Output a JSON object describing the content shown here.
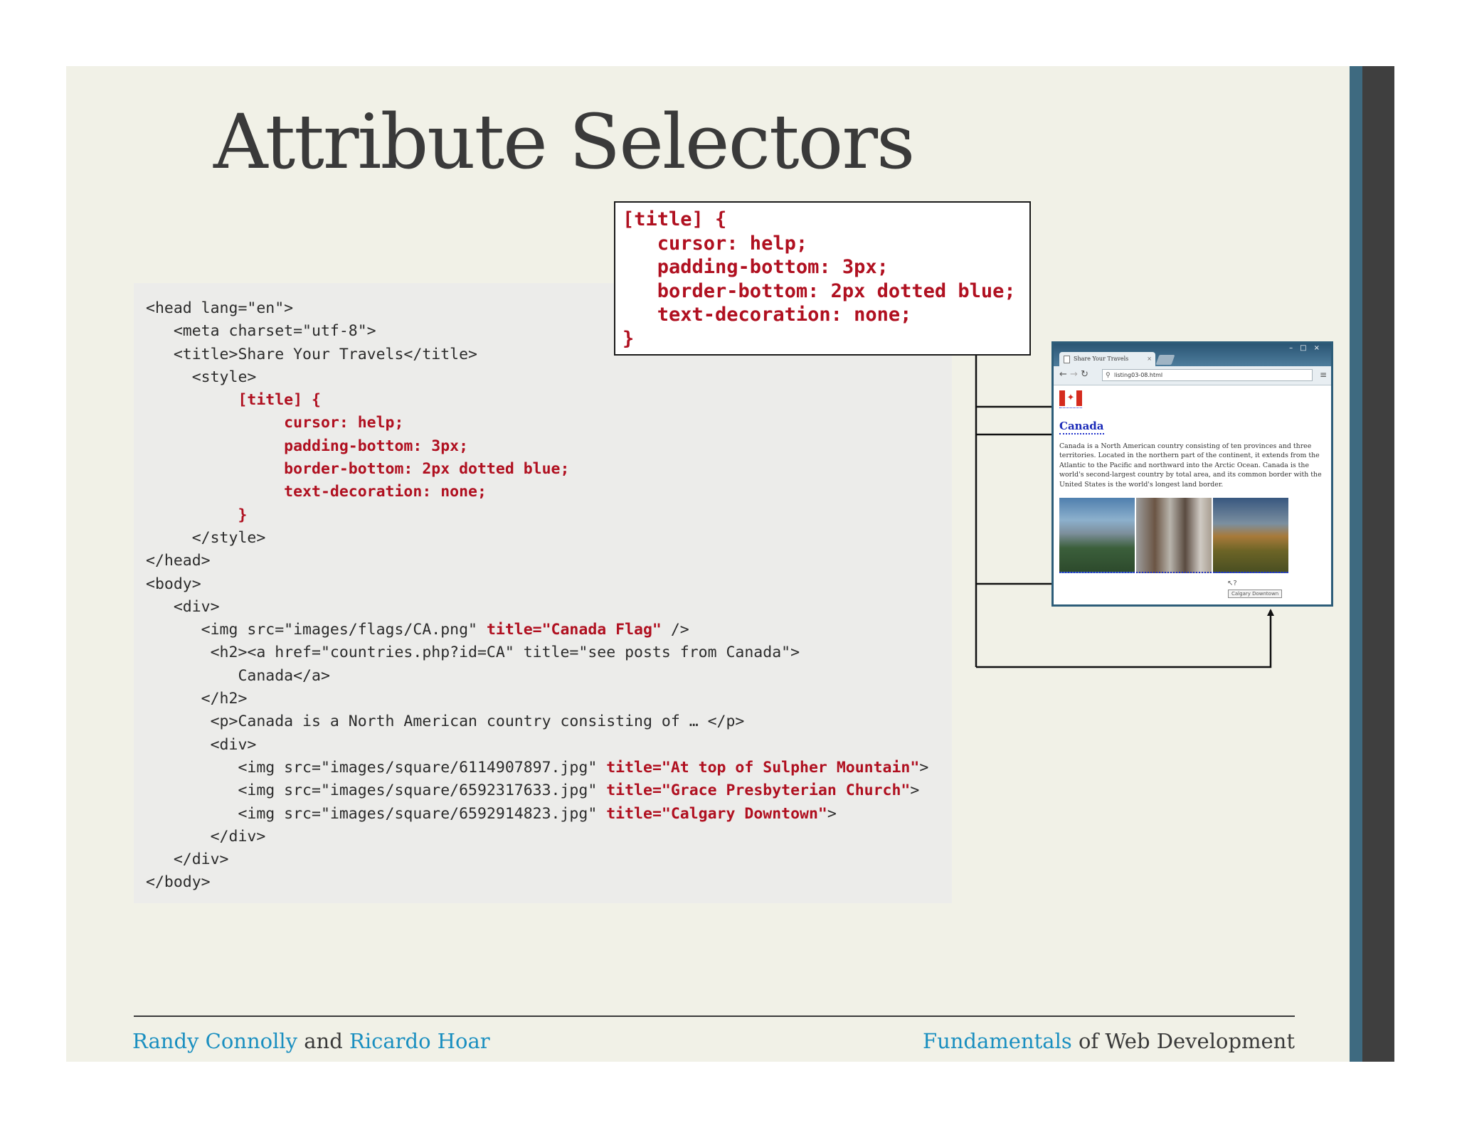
{
  "slide": {
    "title": "Attribute Selectors"
  },
  "code": {
    "l1": "<head lang=\"en\">",
    "l2": "   <meta charset=\"utf-8\">",
    "l3": "   <title>Share Your Travels</title>",
    "l4": "     <style>",
    "l5": "          [title] {",
    "l6": "               cursor: help;",
    "l7": "               padding-bottom: 3px;",
    "l8": "               border-bottom: 2px dotted blue;",
    "l9": "               text-decoration: none;",
    "l10": "          }",
    "l11": "     </style>",
    "l12": "</head>",
    "l13": "<body>",
    "l14": "   <div>",
    "l15a": "      <img src=\"images/flags/CA.png\" ",
    "l15b": "title=\"Canada Flag\"",
    "l15c": " />",
    "l16": "       <h2><a href=\"countries.php?id=CA\" title=\"see posts from Canada\">",
    "l17": "          Canada</a>",
    "l18": "      </h2>",
    "l19": "       <p>Canada is a North American country consisting of … </p>",
    "l20": "       <div>",
    "l21a": "          <img src=\"images/square/6114907897.jpg\" ",
    "l21b": "title=\"At top of Sulpher Mountain\"",
    "l21c": ">",
    "l22a": "          <img src=\"images/square/6592317633.jpg\" ",
    "l22b": "title=\"Grace Presbyterian Church\"",
    "l22c": ">",
    "l23a": "          <img src=\"images/square/6592914823.jpg\" ",
    "l23b": "title=\"Calgary Downtown\"",
    "l23c": ">",
    "l24": "       </div>",
    "l25": "   </div>",
    "l26": "</body>"
  },
  "css_callout": {
    "l1": "[title] {",
    "l2": "   cursor: help;",
    "l3": "   padding-bottom: 3px;",
    "l4": "   border-bottom: 2px dotted blue;",
    "l5": "   text-decoration: none;",
    "l6": "}"
  },
  "browser": {
    "tab_title": "Share Your Travels",
    "url": "listing03-08.html",
    "heading": "Canada",
    "paragraph": "Canada is a North American country consisting of ten provinces and three territories. Located in the northern part of the continent, it extends from the Atlantic to the Pacific and northward into the Arctic Ocean. Canada is the world's second-largest country by total area, and its common border with the United States is the world's longest land border.",
    "tooltip": "Calgary Downtown"
  },
  "footer": {
    "author1": "Randy Connolly",
    "and": " and ",
    "author2": "Ricardo Hoar",
    "book_accent": "Fundamentals",
    "book_rest": " of Web Development"
  },
  "colors": {
    "slide_background": "#f1f1e7",
    "highlight_red": "#b01020",
    "accent_blue": "#1a8fc0",
    "side_bar_blue": "#3e6a80",
    "side_bar_dark": "#3f3f3f"
  }
}
